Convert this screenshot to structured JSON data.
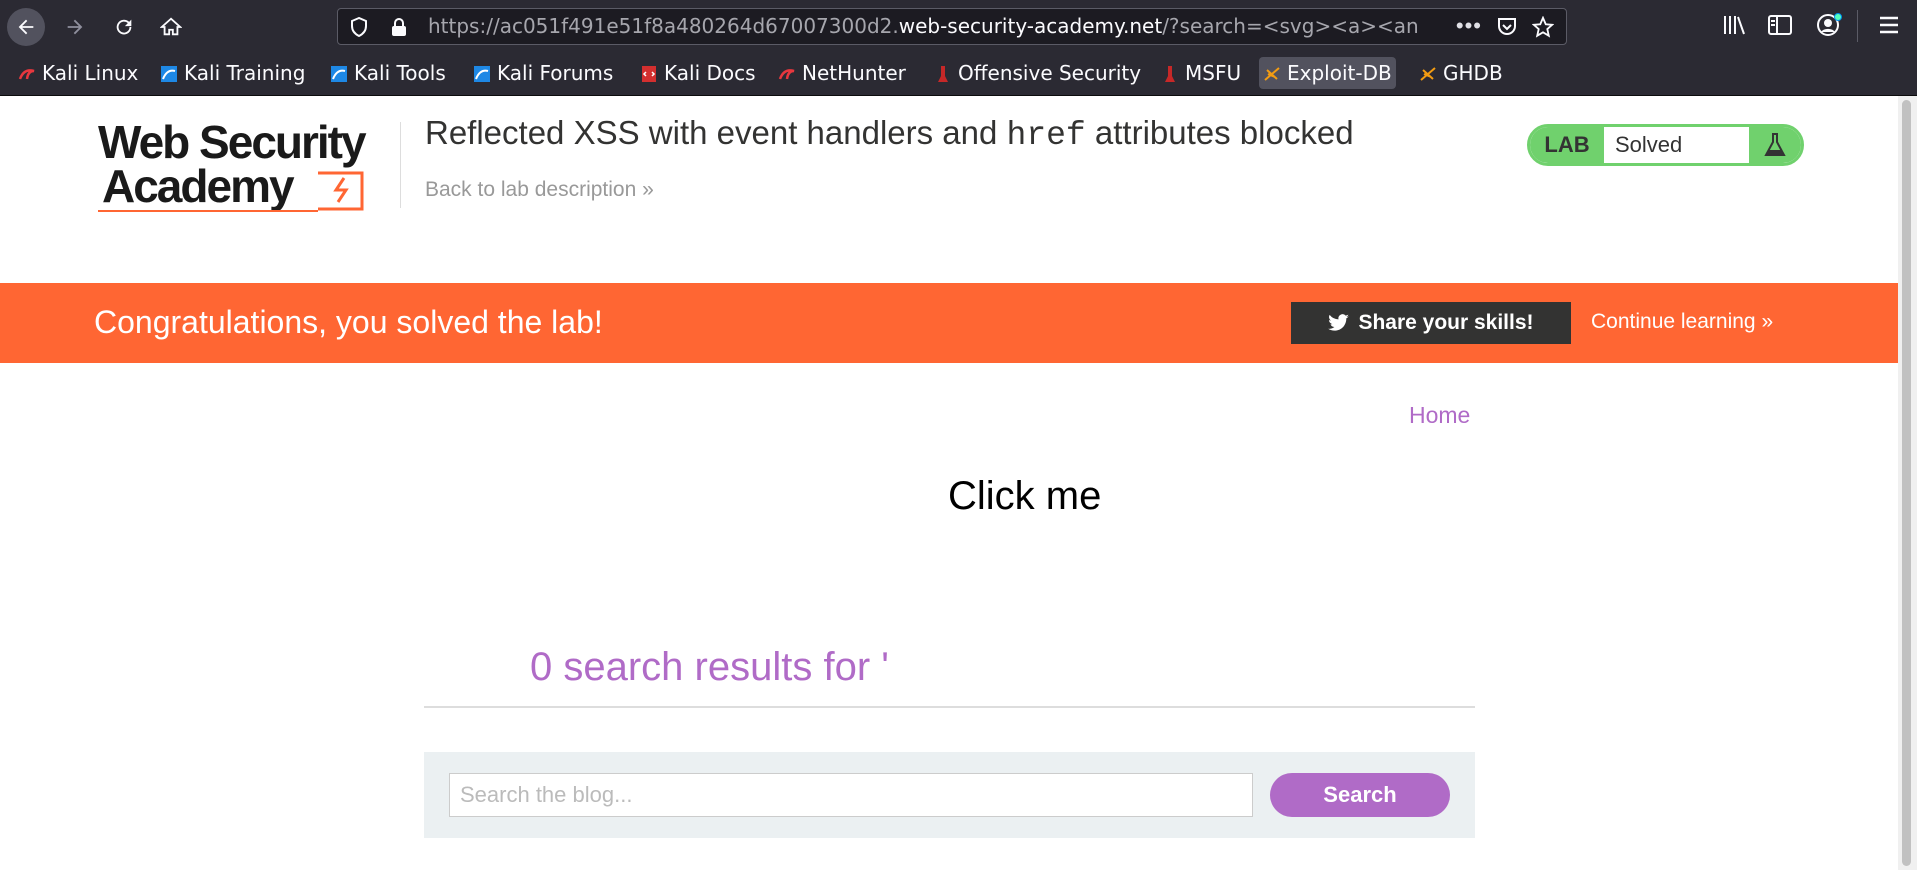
{
  "browser": {
    "url_prefix": "https://ac051f491e51f8a480264d67007300d2.",
    "url_host": "web-security-academy.net",
    "url_rest": "/?search=<svg><a><an",
    "bookmarks": [
      {
        "label": "Kali Linux"
      },
      {
        "label": "Kali Training"
      },
      {
        "label": "Kali Tools"
      },
      {
        "label": "Kali Forums"
      },
      {
        "label": "Kali Docs"
      },
      {
        "label": "NetHunter"
      },
      {
        "label": "Offensive Security"
      },
      {
        "label": "MSFU"
      },
      {
        "label": "Exploit-DB"
      },
      {
        "label": "GHDB"
      }
    ]
  },
  "header": {
    "logo_line1": "Web Security",
    "logo_line2": "Academy",
    "title_pre": "Reflected XSS with event handlers and ",
    "title_code": "href",
    "title_post": " attributes blocked",
    "back_link": "Back to lab description",
    "back_chevron": "»"
  },
  "lab_badge": {
    "label": "LAB",
    "status": "Solved"
  },
  "banner": {
    "message": "Congratulations, you solved the lab!",
    "share_label": "Share your skills!",
    "continue_label": "Continue learning",
    "continue_chevron": "»"
  },
  "main": {
    "home_link": "Home",
    "click_me": "Click me",
    "results_text": "0 search results for '",
    "search_placeholder": "Search the blog...",
    "search_button": "Search"
  },
  "colors": {
    "accent_orange": "#ff6633",
    "accent_purple": "#b06bc7",
    "solved_green": "#70d16d"
  }
}
